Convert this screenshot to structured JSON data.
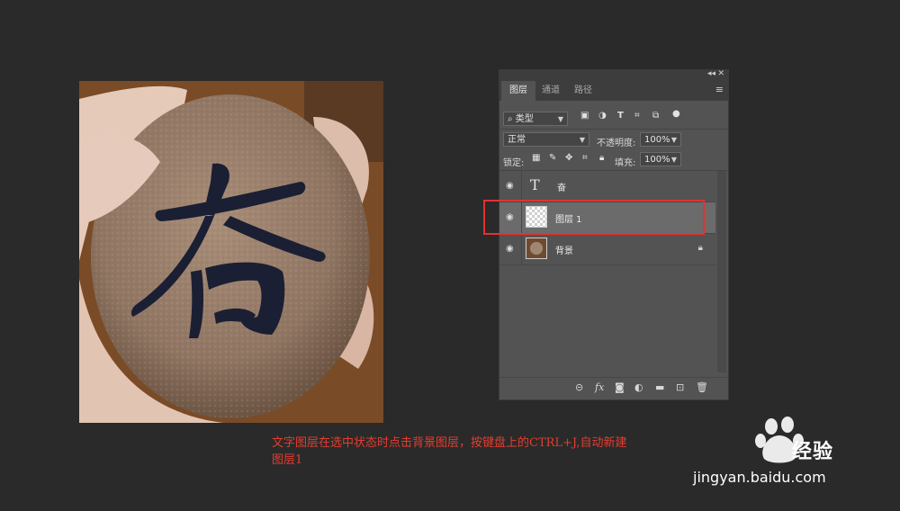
{
  "panel": {
    "collapse_icon": "collapse-icon",
    "close_icon": "close-icon",
    "tabs": [
      {
        "label": "图层",
        "active": true
      },
      {
        "label": "通道",
        "active": false
      },
      {
        "label": "路径",
        "active": false
      }
    ],
    "menu_icon": "hamburger-menu-icon",
    "filter": {
      "value": "类型",
      "search_icon": "search-icon"
    },
    "filter_icons": [
      "image-icon",
      "adjustment-icon",
      "text-icon",
      "shape-icon",
      "smart-object-icon",
      "toggle-dot-icon"
    ],
    "blend_mode": "正常",
    "opacity_label": "不透明度:",
    "opacity_value": "100%",
    "lock_label": "锁定:",
    "lock_icons": [
      "lock-transparent-icon",
      "lock-brush-icon",
      "lock-move-icon",
      "lock-artboard-icon",
      "lock-all-icon"
    ],
    "fill_label": "填充:",
    "fill_value": "100%",
    "layers": [
      {
        "name": "奋",
        "kind": "text",
        "selected": false
      },
      {
        "name": "图层 1",
        "kind": "pixel-transparent",
        "selected": true
      },
      {
        "name": "背景",
        "kind": "background",
        "selected": false,
        "locked": true
      }
    ],
    "footer_icons": [
      "link-icon",
      "fx-icon",
      "mask-icon",
      "adjustment-layer-icon",
      "folder-icon",
      "new-layer-icon",
      "trash-icon"
    ],
    "footer_fx": "fx"
  },
  "canvas": {
    "glyph": "奋",
    "colors": {
      "stone": "#9a7d68",
      "glyph": "#1b1f33",
      "hand": "#e8cdbf",
      "bg": "#7b4e2b"
    }
  },
  "caption": {
    "line1": "文字图层在选中状态时点击背景图层，按键盘上的CTRL+J,自动新建",
    "line2": "图层1"
  },
  "watermark": {
    "brand": "经验",
    "url": "jingyan.baidu.com"
  },
  "colors": {
    "highlight": "#e53131",
    "caption": "#e53d2f",
    "panel_bg": "#535353"
  }
}
